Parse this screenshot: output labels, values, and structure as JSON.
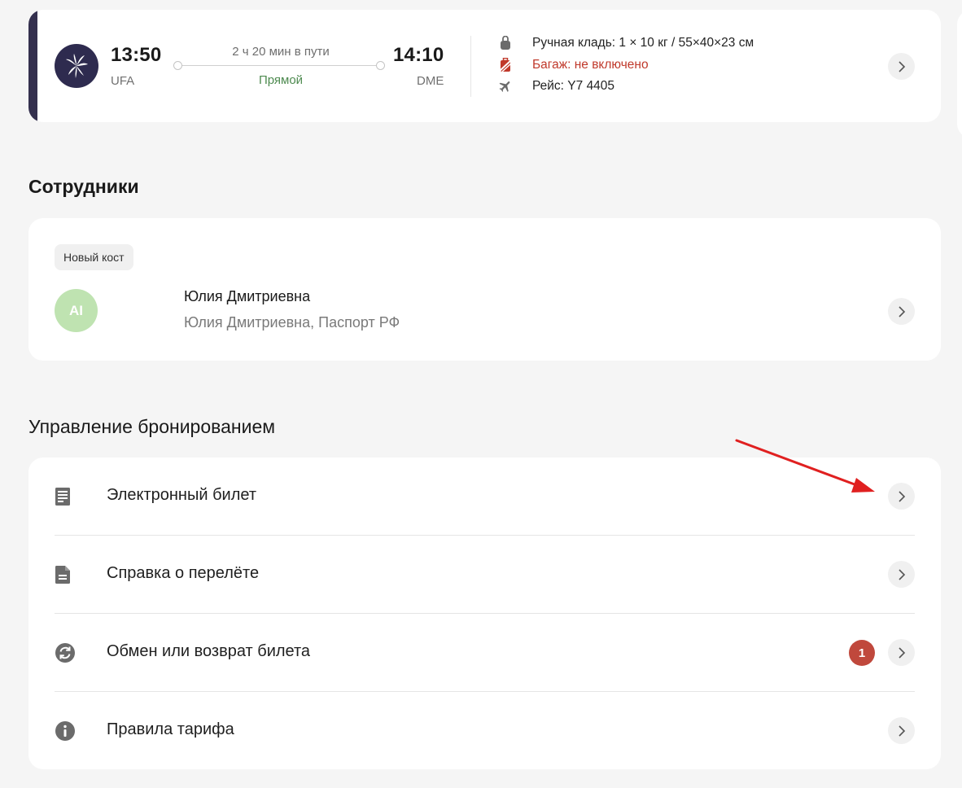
{
  "flight": {
    "departure_time": "13:50",
    "departure_airport": "UFA",
    "duration": "2 ч 20 мин в пути",
    "route_type": "Прямой",
    "arrival_time": "14:10",
    "arrival_airport": "DME",
    "carry_on": "Ручная кладь: 1 × 10 кг / 55×40×23 см",
    "baggage": "Багаж: не включено",
    "flight_number": "Рейс: Y7 4405",
    "accent_color": "#34304e",
    "baggage_color": "#c0392b",
    "direct_color": "#4d8a4f"
  },
  "employees": {
    "title": "Сотрудники",
    "cost_center": "Новый кост",
    "avatar_initials": "AI",
    "avatar_color": "#bfe3b1",
    "name": "Юлия Дмитриевна",
    "document": "Юлия Дмитриевна, Паспорт РФ"
  },
  "manage": {
    "title": "Управление бронированием",
    "items": [
      {
        "label": "Электронный билет",
        "icon": "ticket-document-icon"
      },
      {
        "label": "Справка о перелёте",
        "icon": "file-icon"
      },
      {
        "label": "Обмен или возврат билета",
        "icon": "exchange-icon",
        "badge": "1"
      },
      {
        "label": "Правила тарифа",
        "icon": "info-icon"
      }
    ],
    "badge_color": "#c0483c"
  },
  "annotation": {
    "arrow_color": "#e02020"
  }
}
